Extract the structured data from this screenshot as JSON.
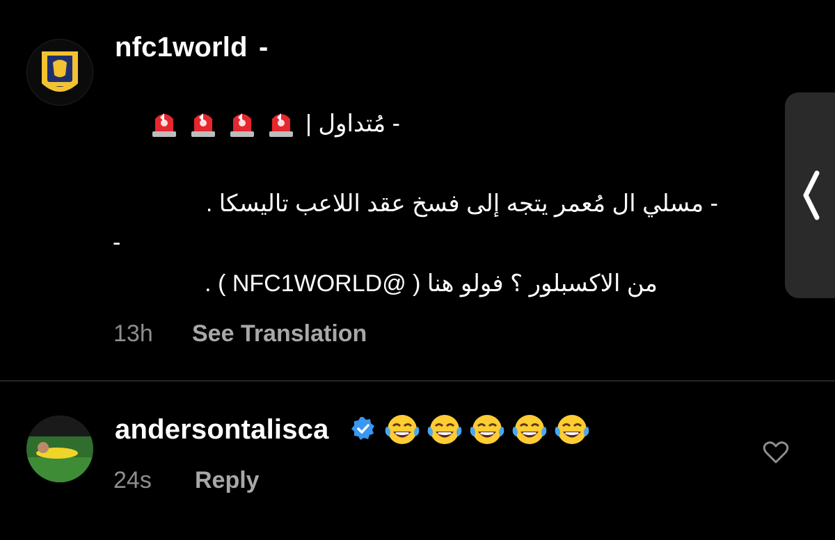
{
  "post": {
    "username": "nfc1world",
    "dash": "-",
    "tag_text": "- مُتداول |",
    "siren_icon": "police-siren",
    "siren_count": 4,
    "body_line": "- مسلي ال مُعمر يتجه إلى فسخ عقد اللاعب تاليسكا .",
    "dash_line": "-",
    "follow_line": "من الاكسبلور ؟ فولو هنا ( @NFC1WORLD ) .",
    "time": "13h",
    "see_translation": "See Translation"
  },
  "reply": {
    "username": "andersontalisca",
    "verified_icon": "verified-badge",
    "emoji": "face-with-tears-of-joy",
    "emoji_count": 5,
    "time": "24s",
    "reply_label": "Reply"
  },
  "colors": {
    "background": "#000000",
    "text": "#ffffff",
    "muted": "#8e8e8e",
    "verified": "#3897f0",
    "divider": "#262626",
    "gold": "#f2c230"
  }
}
